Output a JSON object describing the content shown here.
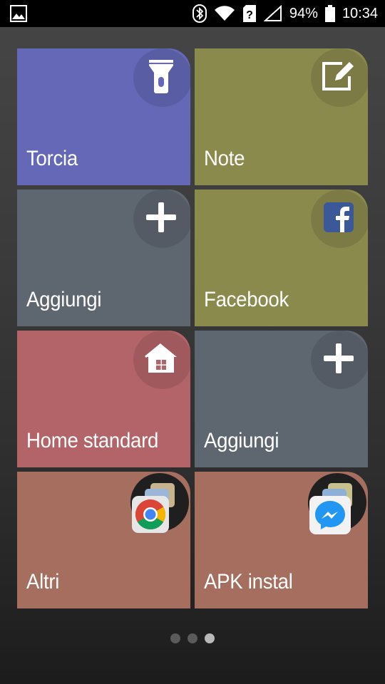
{
  "status_bar": {
    "battery_percent": "94%",
    "time": "10:34",
    "icons": [
      "image-icon",
      "bluetooth-icon",
      "wifi-icon",
      "sim-unknown-icon",
      "signal-icon",
      "battery-icon"
    ]
  },
  "tiles": [
    {
      "label": "Torcia",
      "icon": "flashlight-icon",
      "color": "#6468b6"
    },
    {
      "label": "Note",
      "icon": "edit-note-icon",
      "color": "#8b8a4d"
    },
    {
      "label": "Aggiungi",
      "icon": "plus-icon",
      "color": "#5e6670"
    },
    {
      "label": "Facebook",
      "icon": "facebook-icon",
      "color": "#8b8a4d"
    },
    {
      "label": "Home standard",
      "icon": "home-icon",
      "color": "#b36468"
    },
    {
      "label": "Aggiungi",
      "icon": "plus-icon",
      "color": "#5e6670"
    },
    {
      "label": "Altri",
      "icon": "chrome-stack-icon",
      "color": "#a56e5e"
    },
    {
      "label": "APK instal",
      "icon": "messenger-stack-icon",
      "color": "#a56e5e"
    }
  ],
  "pager": {
    "pages": 3,
    "active_index": 2
  }
}
